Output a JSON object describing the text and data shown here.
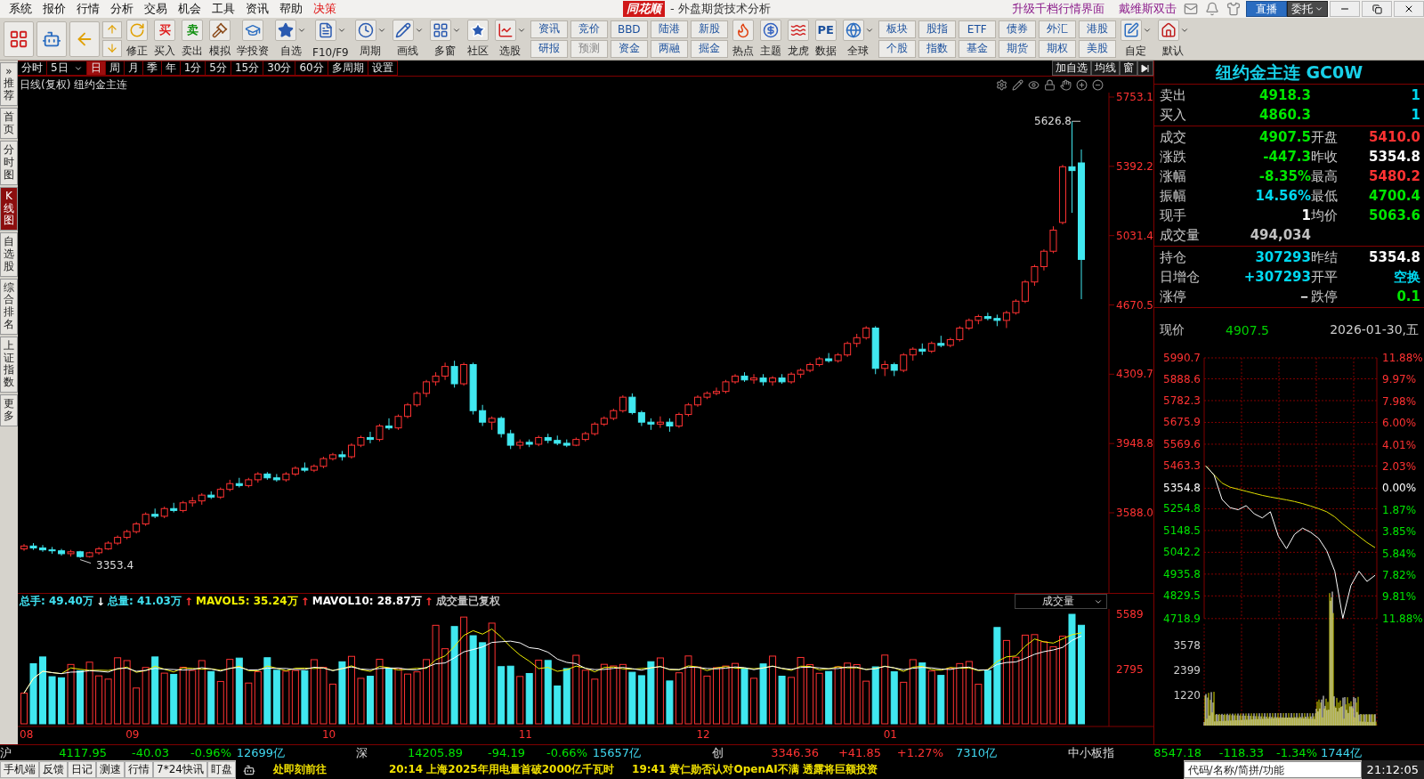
{
  "menu": [
    {
      "label": "系统",
      "highlight": false
    },
    {
      "label": "报价",
      "highlight": false
    },
    {
      "label": "行情",
      "highlight": false
    },
    {
      "label": "分析",
      "highlight": false
    },
    {
      "label": "交易",
      "highlight": false
    },
    {
      "label": "机会",
      "highlight": false
    },
    {
      "label": "工具",
      "highlight": false
    },
    {
      "label": "资讯",
      "highlight": false
    },
    {
      "label": "帮助",
      "highlight": false
    },
    {
      "label": "决策",
      "highlight": true
    }
  ],
  "app_title": {
    "logo": "同花顺",
    "title": "- 外盘期货技术分析"
  },
  "menu_right": {
    "links": [
      "升级千档行情界面",
      "戴维斯双击"
    ],
    "live": "直播",
    "order": "委托"
  },
  "toolbar": {
    "tools": [
      {
        "label": "修正",
        "dropdown": false
      },
      {
        "label": "买入",
        "glyph": "买",
        "dropdown": false
      },
      {
        "label": "卖出",
        "glyph": "卖",
        "dropdown": false
      },
      {
        "label": "模拟",
        "dropdown": false
      },
      {
        "label": "学投资",
        "dropdown": false
      },
      {
        "label": "自选",
        "dropdown": true
      },
      {
        "label": "F10/F9",
        "dropdown": true
      },
      {
        "label": "周期",
        "dropdown": true
      },
      {
        "label": "画线",
        "dropdown": true
      },
      {
        "label": "多窗",
        "dropdown": true
      },
      {
        "label": "社区",
        "dropdown": false
      },
      {
        "label": "选股",
        "dropdown": true
      }
    ],
    "grid1": [
      [
        {
          "label": "资讯",
          "disabled": false
        },
        {
          "label": "研报",
          "disabled": false
        }
      ],
      [
        {
          "label": "竞价",
          "disabled": false
        },
        {
          "label": "预测",
          "disabled": true
        }
      ],
      [
        {
          "label": "BBD",
          "disabled": false
        },
        {
          "label": "资金",
          "disabled": false
        }
      ],
      [
        {
          "label": "陆港",
          "disabled": false
        },
        {
          "label": "两融",
          "disabled": false
        }
      ],
      [
        {
          "label": "新股",
          "disabled": false
        },
        {
          "label": "掘金",
          "disabled": false
        }
      ]
    ],
    "tools2": [
      {
        "label": "热点",
        "dropdown": false
      },
      {
        "label": "主题",
        "dropdown": false
      },
      {
        "label": "龙虎",
        "dropdown": false
      },
      {
        "label": "数据",
        "glyph": "PE",
        "dropdown": false
      },
      {
        "label": "全球",
        "dropdown": true
      }
    ],
    "grid2": [
      [
        {
          "label": "板块",
          "disabled": false
        },
        {
          "label": "个股",
          "disabled": false
        }
      ],
      [
        {
          "label": "股指",
          "disabled": false
        },
        {
          "label": "指数",
          "disabled": false
        }
      ],
      [
        {
          "label": "ETF",
          "disabled": false
        },
        {
          "label": "基金",
          "disabled": false
        }
      ],
      [
        {
          "label": "债券",
          "disabled": false
        },
        {
          "label": "期货",
          "disabled": false
        }
      ],
      [
        {
          "label": "外汇",
          "disabled": false
        },
        {
          "label": "期权",
          "disabled": false
        }
      ],
      [
        {
          "label": "港股",
          "disabled": false
        },
        {
          "label": "美股",
          "disabled": false
        }
      ]
    ],
    "tools3": [
      {
        "label": "自定",
        "dropdown": true
      },
      {
        "label": "默认",
        "dropdown": true
      }
    ]
  },
  "side_tabs": [
    {
      "label": "推荐",
      "prefix": "»",
      "selected": false
    },
    {
      "label": "首页",
      "selected": false
    },
    {
      "label": "分时图",
      "selected": false
    },
    {
      "label": "K线图",
      "selected": true
    },
    {
      "label": "自选股",
      "selected": false
    },
    {
      "label": "综合排名",
      "selected": false
    },
    {
      "label": "上证指数",
      "selected": false
    },
    {
      "label": "更多",
      "selected": false
    }
  ],
  "period_tabs": [
    {
      "label": "分时",
      "selected": false,
      "dropdown": false
    },
    {
      "label": "5日",
      "selected": false,
      "dropdown": true
    },
    {
      "label": "日",
      "selected": true,
      "dropdown": false
    },
    {
      "label": "周",
      "selected": false,
      "dropdown": false
    },
    {
      "label": "月",
      "selected": false,
      "dropdown": false
    },
    {
      "label": "季",
      "selected": false,
      "dropdown": false
    },
    {
      "label": "年",
      "selected": false,
      "dropdown": false
    },
    {
      "label": "1分",
      "selected": false,
      "dropdown": false
    },
    {
      "label": "5分",
      "selected": false,
      "dropdown": false
    },
    {
      "label": "15分",
      "selected": false,
      "dropdown": false
    },
    {
      "label": "30分",
      "selected": false,
      "dropdown": false
    },
    {
      "label": "60分",
      "selected": false,
      "dropdown": false
    },
    {
      "label": "多周期",
      "selected": false,
      "dropdown": false
    },
    {
      "label": "设置",
      "selected": false,
      "dropdown": false
    }
  ],
  "chart_buttons": [
    "加自选",
    "均线",
    "窗"
  ],
  "chart": {
    "mode": "日线(复权)",
    "name": "纽约金主连",
    "high_mark": "5626.8",
    "low_mark": "3353.4",
    "chart_data": {
      "type": "candlestick",
      "ylim": [
        3170.7,
        5776.3
      ],
      "yticks": [
        {
          "value": 5753.1,
          "label": "5753.1"
        },
        {
          "value": 5392.2,
          "label": "5392.2"
        },
        {
          "value": 5031.4,
          "label": "5031.4"
        },
        {
          "value": 4670.5,
          "label": "4670.5"
        },
        {
          "value": 4309.7,
          "label": "4309.7"
        },
        {
          "value": 3948.8,
          "label": "3948.8"
        },
        {
          "value": 3588,
          "label": "3588.0"
        }
      ],
      "ohlc": [
        [
          3400,
          3425,
          3390,
          3415
        ],
        [
          3415,
          3430,
          3395,
          3405
        ],
        [
          3405,
          3420,
          3385,
          3395
        ],
        [
          3395,
          3410,
          3375,
          3390
        ],
        [
          3390,
          3400,
          3365,
          3375
        ],
        [
          3375,
          3395,
          3360,
          3385
        ],
        [
          3385,
          3390,
          3353.4,
          3360
        ],
        [
          3360,
          3385,
          3355,
          3380
        ],
        [
          3380,
          3410,
          3370,
          3400
        ],
        [
          3400,
          3440,
          3395,
          3430
        ],
        [
          3430,
          3470,
          3420,
          3460
        ],
        [
          3460,
          3500,
          3450,
          3490
        ],
        [
          3490,
          3540,
          3480,
          3530
        ],
        [
          3530,
          3590,
          3520,
          3580
        ],
        [
          3580,
          3610,
          3560,
          3570
        ],
        [
          3570,
          3620,
          3560,
          3610
        ],
        [
          3610,
          3640,
          3590,
          3600
        ],
        [
          3600,
          3650,
          3590,
          3640
        ],
        [
          3640,
          3670,
          3620,
          3650
        ],
        [
          3650,
          3690,
          3630,
          3680
        ],
        [
          3680,
          3700,
          3660,
          3670
        ],
        [
          3670,
          3720,
          3660,
          3710
        ],
        [
          3710,
          3760,
          3700,
          3740
        ],
        [
          3740,
          3770,
          3720,
          3730
        ],
        [
          3730,
          3770,
          3720,
          3760
        ],
        [
          3760,
          3800,
          3745,
          3790
        ],
        [
          3790,
          3800,
          3760,
          3770
        ],
        [
          3770,
          3790,
          3750,
          3760
        ],
        [
          3760,
          3800,
          3750,
          3790
        ],
        [
          3790,
          3830,
          3780,
          3820
        ],
        [
          3820,
          3850,
          3800,
          3810
        ],
        [
          3810,
          3840,
          3800,
          3830
        ],
        [
          3830,
          3880,
          3820,
          3870
        ],
        [
          3870,
          3900,
          3860,
          3890
        ],
        [
          3890,
          3910,
          3860,
          3880
        ],
        [
          3880,
          3950,
          3870,
          3940
        ],
        [
          3940,
          3990,
          3930,
          3980
        ],
        [
          3980,
          4010,
          3950,
          3970
        ],
        [
          3970,
          4050,
          3960,
          4040
        ],
        [
          4040,
          4080,
          4020,
          4030
        ],
        [
          4030,
          4100,
          4020,
          4090
        ],
        [
          4090,
          4160,
          4080,
          4150
        ],
        [
          4150,
          4220,
          4140,
          4210
        ],
        [
          4210,
          4280,
          4190,
          4270
        ],
        [
          4270,
          4320,
          4250,
          4300
        ],
        [
          4300,
          4370,
          4280,
          4350
        ],
        [
          4350,
          4380,
          4240,
          4260
        ],
        [
          4260,
          4370,
          4250,
          4360
        ],
        [
          4360,
          4370,
          4100,
          4120
        ],
        [
          4120,
          4150,
          4040,
          4060
        ],
        [
          4060,
          4090,
          4020,
          4080
        ],
        [
          4080,
          4090,
          3980,
          4000
        ],
        [
          4000,
          4020,
          3920,
          3940
        ],
        [
          3940,
          3970,
          3920,
          3955
        ],
        [
          3955,
          3970,
          3930,
          3945
        ],
        [
          3945,
          3990,
          3935,
          3980
        ],
        [
          3980,
          4000,
          3950,
          3965
        ],
        [
          3965,
          3990,
          3940,
          3950
        ],
        [
          3950,
          3970,
          3930,
          3940
        ],
        [
          3940,
          3980,
          3935,
          3970
        ],
        [
          3970,
          4010,
          3960,
          4000
        ],
        [
          4000,
          4060,
          3990,
          4050
        ],
        [
          4050,
          4090,
          4040,
          4080
        ],
        [
          4080,
          4130,
          4070,
          4120
        ],
        [
          4120,
          4200,
          4110,
          4190
        ],
        [
          4190,
          4210,
          4100,
          4110
        ],
        [
          4110,
          4120,
          4040,
          4060
        ],
        [
          4060,
          4080,
          4020,
          4050
        ],
        [
          4050,
          4090,
          4030,
          4060
        ],
        [
          4060,
          4080,
          4010,
          4040
        ],
        [
          4040,
          4110,
          4030,
          4100
        ],
        [
          4100,
          4160,
          4090,
          4150
        ],
        [
          4150,
          4200,
          4140,
          4190
        ],
        [
          4190,
          4220,
          4180,
          4210
        ],
        [
          4210,
          4240,
          4200,
          4220
        ],
        [
          4220,
          4280,
          4210,
          4270
        ],
        [
          4270,
          4310,
          4260,
          4300
        ],
        [
          4300,
          4320,
          4270,
          4280
        ],
        [
          4280,
          4310,
          4260,
          4290
        ],
        [
          4290,
          4310,
          4250,
          4270
        ],
        [
          4270,
          4300,
          4250,
          4290
        ],
        [
          4290,
          4310,
          4260,
          4270
        ],
        [
          4270,
          4320,
          4260,
          4310
        ],
        [
          4310,
          4340,
          4290,
          4330
        ],
        [
          4330,
          4370,
          4320,
          4360
        ],
        [
          4360,
          4400,
          4350,
          4390
        ],
        [
          4390,
          4420,
          4370,
          4380
        ],
        [
          4380,
          4420,
          4370,
          4410
        ],
        [
          4410,
          4480,
          4400,
          4470
        ],
        [
          4470,
          4520,
          4450,
          4500
        ],
        [
          4500,
          4560,
          4490,
          4550
        ],
        [
          4550,
          4560,
          4310,
          4340
        ],
        [
          4340,
          4380,
          4300,
          4360
        ],
        [
          4360,
          4370,
          4300,
          4330
        ],
        [
          4330,
          4420,
          4320,
          4410
        ],
        [
          4410,
          4450,
          4380,
          4440
        ],
        [
          4440,
          4470,
          4410,
          4430
        ],
        [
          4430,
          4480,
          4420,
          4470
        ],
        [
          4470,
          4510,
          4450,
          4460
        ],
        [
          4460,
          4500,
          4450,
          4490
        ],
        [
          4490,
          4560,
          4480,
          4550
        ],
        [
          4550,
          4600,
          4540,
          4590
        ],
        [
          4590,
          4620,
          4570,
          4610
        ],
        [
          4610,
          4630,
          4590,
          4600
        ],
        [
          4600,
          4620,
          4560,
          4590
        ],
        [
          4590,
          4640,
          4550,
          4630
        ],
        [
          4630,
          4700,
          4620,
          4690
        ],
        [
          4690,
          4800,
          4680,
          4790
        ],
        [
          4790,
          4880,
          4770,
          4870
        ],
        [
          4870,
          4960,
          4850,
          4950
        ],
        [
          4950,
          5080,
          4940,
          5060
        ],
        [
          5100,
          5400,
          5090,
          5390
        ],
        [
          5390,
          5626.8,
          5150,
          5370
        ],
        [
          5410,
          5480.2,
          4700.4,
          4907.5
        ]
      ]
    }
  },
  "volume": {
    "legend": [
      {
        "label": "总手: 49.40万",
        "color": "#40e0f0"
      },
      {
        "label": "总量: 41.03万",
        "arrow": "↓",
        "color": "#40e0f0"
      },
      {
        "label": "MAVOL5: 35.24万",
        "arrow": "↑",
        "color": "#f0f000"
      },
      {
        "label": "MAVOL10: 28.87万",
        "arrow": "↑",
        "color": "#ffffff"
      },
      {
        "label": "成交量已复权",
        "arrow": "↑",
        "color": "#c0c0c0"
      }
    ],
    "selector": "成交量",
    "ticks": [
      "5589",
      "2795"
    ],
    "dates": [
      "08",
      "09",
      "10",
      "11",
      "12",
      "01"
    ]
  },
  "quote": {
    "title": "纽约金主连 GC0W",
    "sections": [
      [
        {
          "left": {
            "label": "卖出",
            "value": "4918.3",
            "color": "#00e600"
          },
          "right": {
            "value": "1",
            "color": "#00d8f0"
          }
        },
        {
          "left": {
            "label": "买入",
            "value": "4860.3",
            "color": "#00e600"
          },
          "right": {
            "value": "1",
            "color": "#00d8f0"
          }
        }
      ],
      [
        {
          "left": {
            "label": "成交",
            "value": "4907.5",
            "color": "#00e600"
          },
          "right": {
            "label": "开盘",
            "value": "5410.0",
            "color": "#ff3232"
          }
        },
        {
          "left": {
            "label": "涨跌",
            "value": "-447.3",
            "color": "#00e600"
          },
          "right": {
            "label": "昨收",
            "value": "5354.8",
            "color": "#ffffff"
          }
        },
        {
          "left": {
            "label": "涨幅",
            "value": "-8.35%",
            "color": "#00e600"
          },
          "right": {
            "label": "最高",
            "value": "5480.2",
            "color": "#ff3232"
          }
        },
        {
          "left": {
            "label": "振幅",
            "value": "14.56%",
            "color": "#00d8f0"
          },
          "right": {
            "label": "最低",
            "value": "4700.4",
            "color": "#00e600"
          }
        },
        {
          "left": {
            "label": "现手",
            "value": "1",
            "color": "#ffffff"
          },
          "right": {
            "label": "均价",
            "value": "5063.6",
            "color": "#00e600"
          }
        },
        {
          "left": {
            "label": "成交量",
            "value": "494,034",
            "color": "#c0c0c0"
          }
        }
      ],
      [
        {
          "left": {
            "label": "持仓",
            "value": "307293",
            "color": "#00d8f0"
          },
          "right": {
            "label": "昨结",
            "value": "5354.8",
            "color": "#ffffff"
          }
        },
        {
          "left": {
            "label": "日增仓",
            "value": "+307293",
            "color": "#00d8f0"
          },
          "right": {
            "label": "开平",
            "value": "空换",
            "color": "#00d8f0"
          }
        },
        {
          "left": {
            "label": "涨停",
            "value": "－",
            "color": "#ffffff"
          },
          "right": {
            "label": "跌停",
            "value": "0.1",
            "color": "#00e600"
          }
        }
      ]
    ],
    "now_label": "现价",
    "now_value": "4907.5",
    "date": "2026-01-30,五",
    "right_ticks": [
      {
        "label": "11.88%",
        "color": "#ff3232"
      },
      {
        "label": "9.97%",
        "color": "#ff3232"
      },
      {
        "label": "7.98%",
        "color": "#ff3232"
      },
      {
        "label": "6.00%",
        "color": "#ff3232"
      },
      {
        "label": "4.01%",
        "color": "#ff3232"
      },
      {
        "label": "2.03%",
        "color": "#ff3232"
      },
      {
        "label": "0.00%",
        "color": "#ffffff"
      },
      {
        "label": "1.87%",
        "color": "#00e600"
      },
      {
        "label": "3.85%",
        "color": "#00e600"
      },
      {
        "label": "5.84%",
        "color": "#00e600"
      },
      {
        "label": "7.82%",
        "color": "#00e600"
      },
      {
        "label": "9.81%",
        "color": "#00e600"
      },
      {
        "label": "11.88%",
        "color": "#00e600"
      }
    ],
    "volume_ticks": [
      "3578",
      "2399",
      "1220"
    ],
    "chart_data": {
      "type": "line",
      "grid": true,
      "ylim": [
        4718.9,
        5990.7
      ],
      "yticks": [
        {
          "value": 5990.7,
          "label": "5990.7"
        },
        {
          "value": 5888.6,
          "label": "5888.6"
        },
        {
          "value": 5782.3,
          "label": "5782.3"
        },
        {
          "value": 5675.9,
          "label": "5675.9"
        },
        {
          "value": 5569.6,
          "label": "5569.6"
        },
        {
          "value": 5463.3,
          "label": "5463.3"
        },
        {
          "value": 5354.8,
          "label": "5354.8"
        },
        {
          "value": 5254.8,
          "label": "5254.8"
        },
        {
          "value": 5148.5,
          "label": "5148.5"
        },
        {
          "value": 5042.2,
          "label": "5042.2"
        },
        {
          "value": 4935.8,
          "label": "4935.8"
        },
        {
          "value": 4829.5,
          "label": "4829.5"
        },
        {
          "value": 4718.9,
          "label": "4718.9"
        }
      ],
      "series": [
        {
          "color": "#ffffff",
          "values": [
            5463,
            5420,
            5300,
            5260,
            5250,
            5270,
            5230,
            5210,
            5240,
            5120,
            5060,
            5130,
            5160,
            5140,
            5110,
            5050,
            4950,
            4720,
            4880,
            4950,
            4900,
            4930
          ]
        },
        {
          "color": "#e0e000",
          "values": [
            5463,
            5420,
            5380,
            5360,
            5350,
            5340,
            5330,
            5320,
            5312,
            5305,
            5298,
            5290,
            5280,
            5268,
            5255,
            5240,
            5215,
            5180,
            5150,
            5120,
            5090,
            5065
          ]
        }
      ]
    }
  },
  "indices": [
    {
      "name": "沪",
      "value": "4117.95",
      "change": "-40.03",
      "pct": "-0.96%",
      "amount": "12699亿",
      "rising": false
    },
    {
      "name": "深",
      "value": "14205.89",
      "change": "-94.19",
      "pct": "-0.66%",
      "amount": "15657亿",
      "rising": false
    },
    {
      "name": "创",
      "value": "3346.36",
      "change": "+41.85",
      "pct": "+1.27%",
      "amount": "7310亿",
      "rising": true
    },
    {
      "name": "中小板指",
      "value": "8547.18",
      "change": "-118.33",
      "pct": "-1.34%",
      "amount": "1744亿",
      "rising": false
    }
  ],
  "status_bar": {
    "links": [
      "手机端",
      "反馈",
      "日记",
      "测速",
      "行情",
      "7*24快讯",
      "盯盘"
    ],
    "alert": "处即刻前往",
    "news": [
      "20:14 上海2025年用电量首破2000亿千瓦时",
      "19:41 黄仁勋否认对OpenAI不满 透露将巨额投资"
    ],
    "search": {
      "placeholder": "代码/名称/简拼/功能"
    },
    "time": "21:12:05"
  }
}
